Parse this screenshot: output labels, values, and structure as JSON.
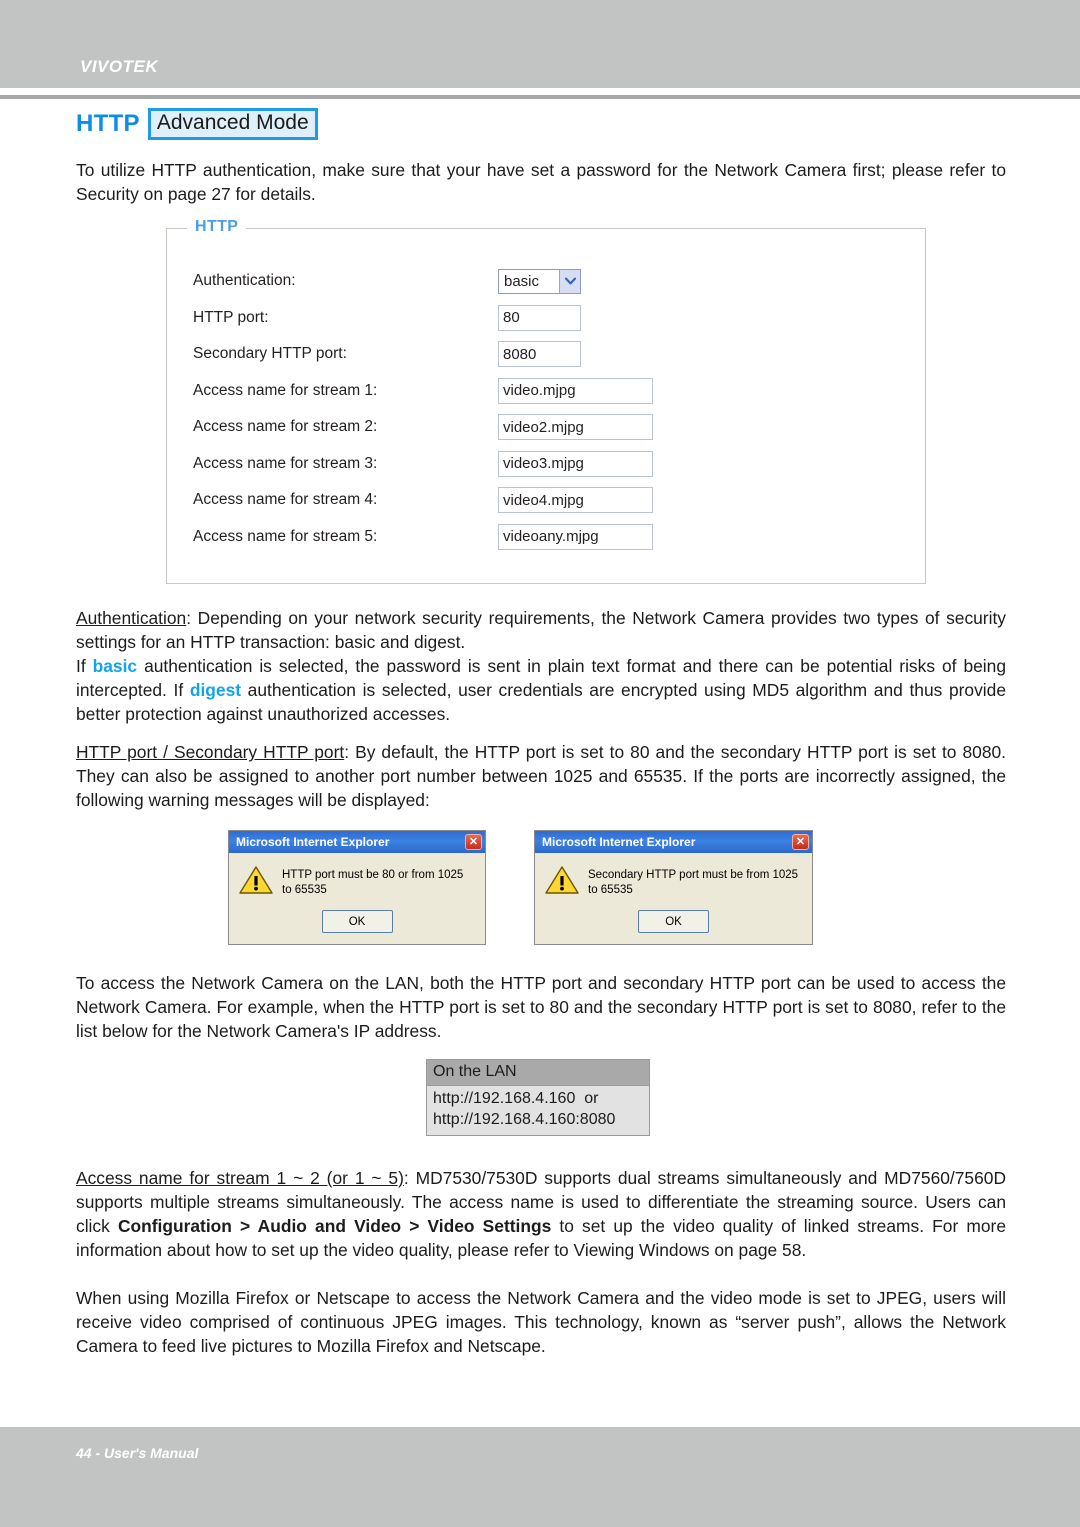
{
  "header": {
    "brand": "VIVOTEK"
  },
  "title": {
    "main": "HTTP",
    "badge": "Advanced Mode"
  },
  "intro": {
    "line": "To utilize HTTP authentication, make sure that your have set a password for the Network Camera first; please refer to Security on page 27 for details."
  },
  "panel": {
    "legend": "HTTP",
    "rows": [
      {
        "label": "Authentication:",
        "value": "basic",
        "type": "select"
      },
      {
        "label": "HTTP port:",
        "value": "80",
        "type": "text-small"
      },
      {
        "label": "Secondary HTTP port:",
        "value": "8080",
        "type": "text-small"
      },
      {
        "label": "Access name for stream 1:",
        "value": "video.mjpg",
        "type": "text-wide"
      },
      {
        "label": "Access name for stream 2:",
        "value": "video2.mjpg",
        "type": "text-wide"
      },
      {
        "label": "Access name for stream 3:",
        "value": "video3.mjpg",
        "type": "text-wide"
      },
      {
        "label": "Access name for stream 4:",
        "value": "video4.mjpg",
        "type": "text-wide"
      },
      {
        "label": "Access name for stream 5:",
        "value": "videoany.mjpg",
        "type": "text-wide"
      }
    ]
  },
  "sections": {
    "authentication": {
      "term": "Authentication",
      "para1_rest": ": Depending on your network security requirements, the Network Camera provides two types of security settings for an HTTP transaction: basic and digest.",
      "para2_a": "If ",
      "para2_basic": "basic",
      "para2_b": " authentication is selected, the password is sent in plain text format and there can be potential risks of being intercepted. If ",
      "para2_digest": "digest",
      "para2_c": " authentication is selected, user credentials are encrypted using MD5 algorithm and thus provide better protection against unauthorized accesses."
    },
    "http_port": {
      "term": "HTTP port / Secondary HTTP port",
      "rest": ": By default, the HTTP port is set to 80 and the secondary HTTP port is set to 8080. They can also be assigned to another port number between 1025 and 65535. If the ports are incorrectly assigned, the following warning messages will be displayed:"
    },
    "lan_intro": "To access the Network Camera on the LAN, both the HTTP port and secondary HTTP port can be used to access the Network Camera. For example, when the HTTP port is set to 80 and the secondary HTTP port is set to 8080, refer to the list below for the Network Camera's IP address.",
    "access_name": {
      "term": "Access name for stream 1 ~ 2 (or 1 ~ 5)",
      "part1": ": MD7530/7530D supports dual streams simultaneously and MD7560/7560D supports multiple streams simultaneously. The access name is used to differentiate the streaming source. Users can click ",
      "bold": "Configuration > Audio and Video > Video Settings",
      "part2": " to set up the video quality of linked streams. For more information about how to set up the video quality, please refer to Viewing Windows on page 58."
    },
    "mozilla": "When using Mozilla Firefox or Netscape to access the Network Camera and the video mode is set to JPEG, users will receive video comprised of continuous JPEG images. This technology, known as “server push”, allows the Network Camera to feed live pictures to Mozilla Firefox and Netscape."
  },
  "dialogs": [
    {
      "title": "Microsoft Internet Explorer",
      "message": "HTTP port must be 80 or from 1025 to 65535",
      "ok_label": "OK",
      "close_label": "✕"
    },
    {
      "title": "Microsoft Internet Explorer",
      "message": "Secondary HTTP port must be from 1025 to 65535",
      "ok_label": "OK",
      "close_label": "✕"
    }
  ],
  "lan_table": {
    "header": "On the LAN",
    "rows": [
      "http://192.168.4.160  or",
      "http://192.168.4.160:8080"
    ]
  },
  "footer": {
    "text": "44 - User's Manual"
  },
  "colors": {
    "accent_blue": "#0c8ee8",
    "legend_blue": "#4b9fe0",
    "highlight": "#13a3e8",
    "band_grey": "#c2c3c3"
  }
}
